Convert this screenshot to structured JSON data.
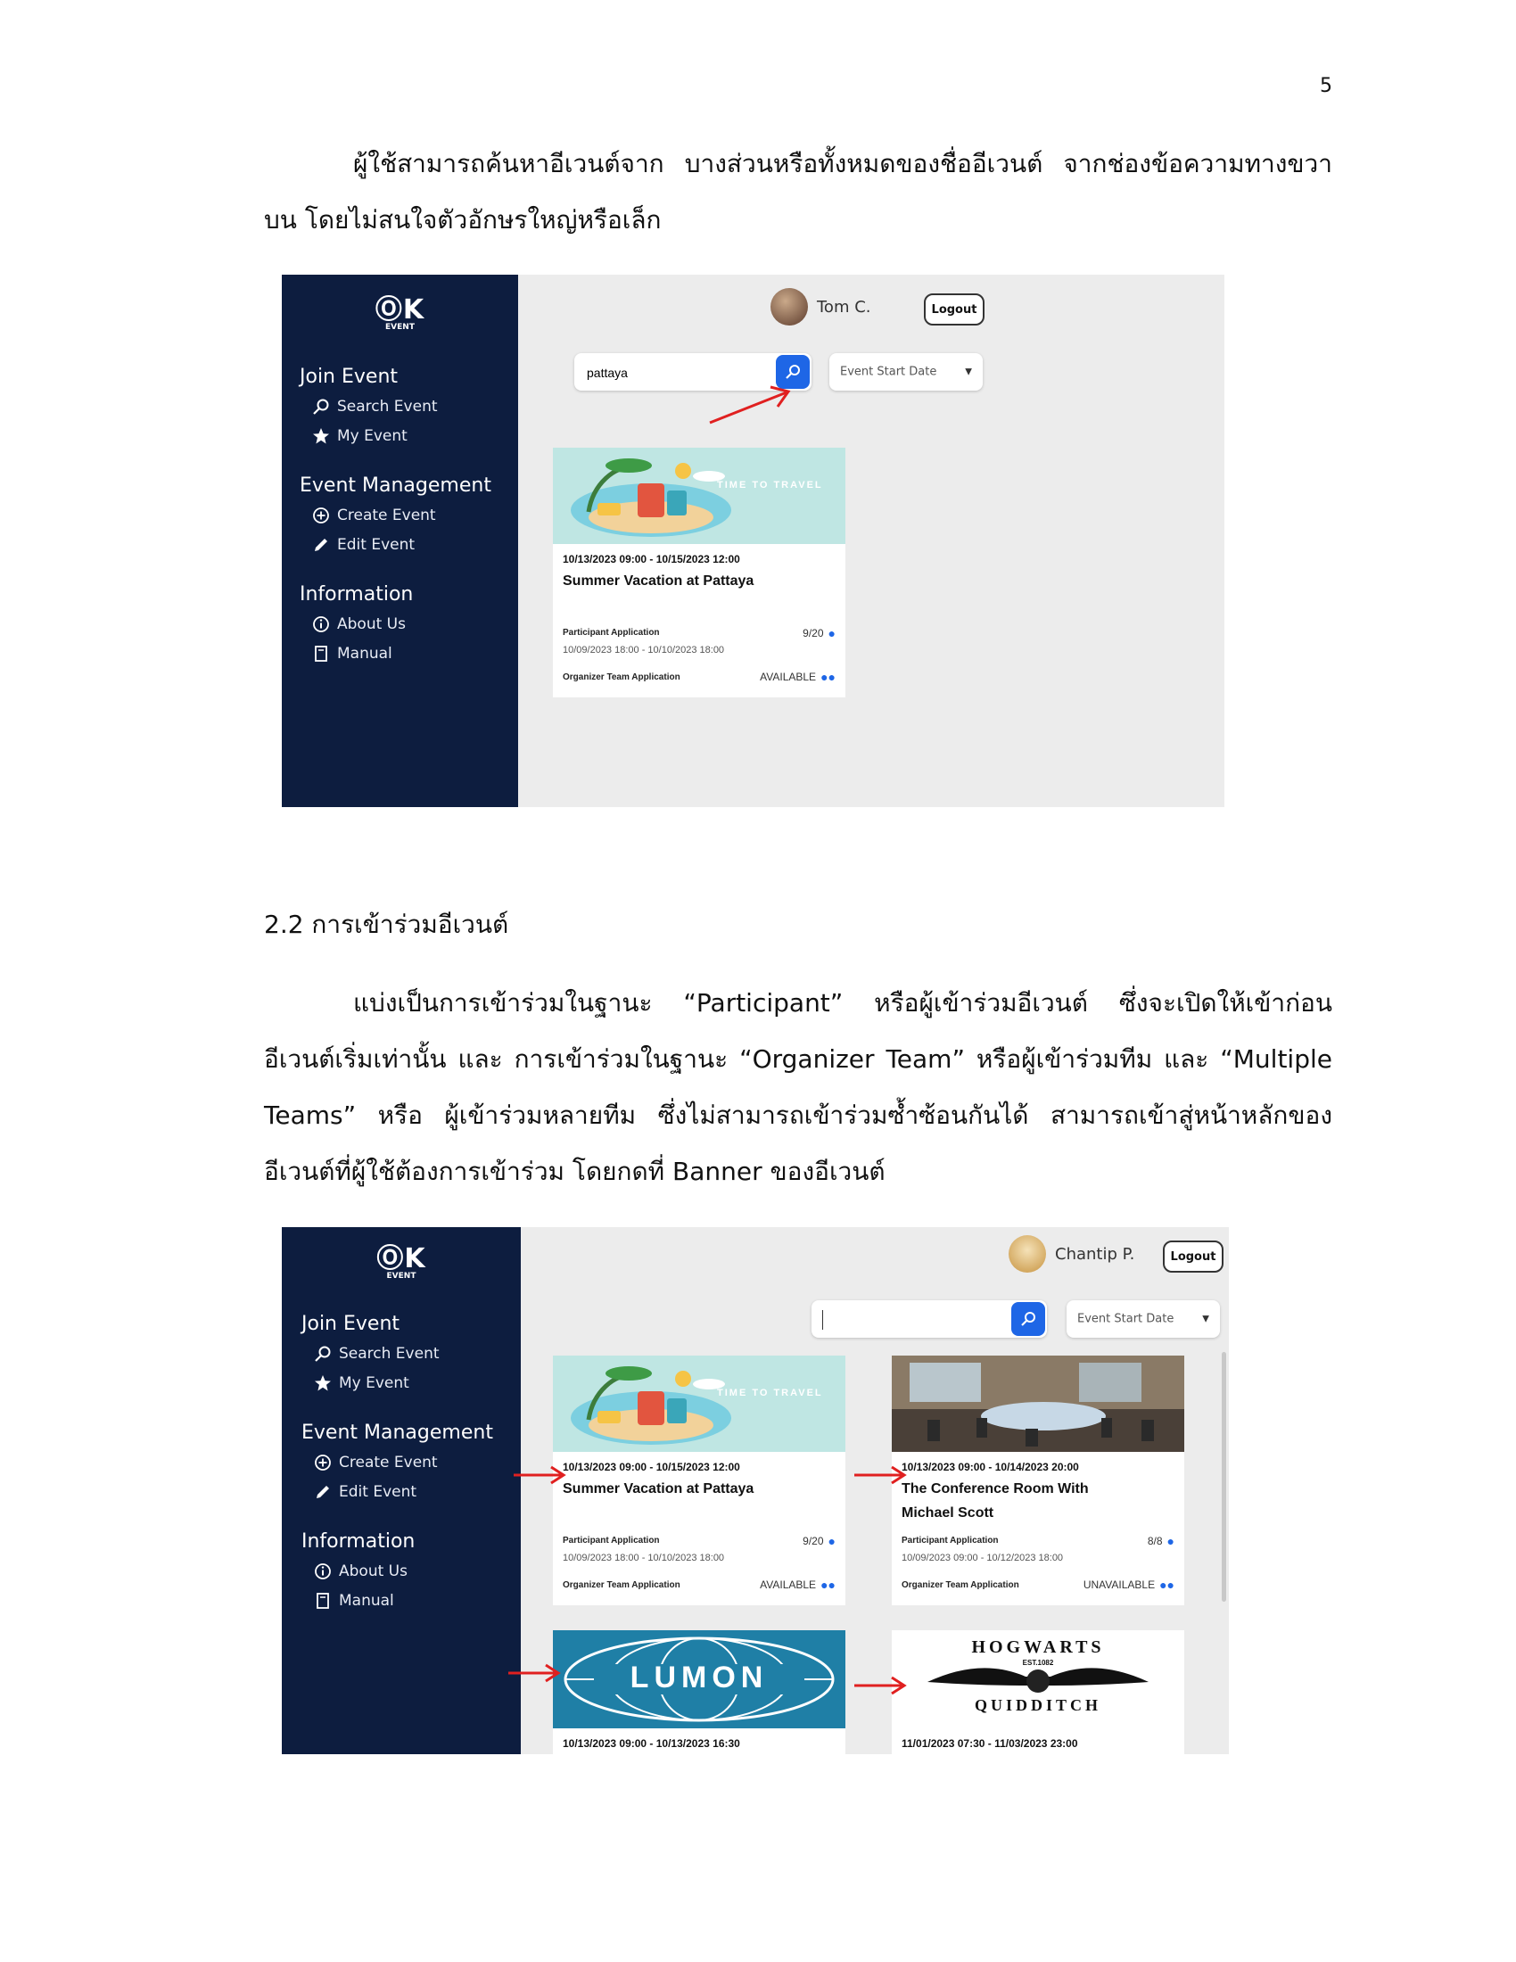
{
  "page_number": "5",
  "intro_paragraph": "ผู้ใช้สามารถค้นหาอีเวนต์จาก บางส่วนหรือทั้งหมดของชื่ออีเวนต์ จากช่องข้อความทางขวาบน โดยไม่สนใจตัวอักษรใหญ่หรือเล็ก",
  "section_heading": "2.2 การเข้าร่วมอีเวนต์",
  "section_paragraph": "แบ่งเป็นการเข้าร่วมในฐานะ “Participant” หรือผู้เข้าร่วมอีเวนต์ ซึ่งจะเปิดให้เข้าก่อน อีเวนต์เริ่มเท่านั้น และ การเข้าร่วมในฐานะ “Organizer Team” หรือผู้เข้าร่วมทีม และ “Multiple Teams” หรือ ผู้เข้าร่วมหลายทีม ซึ่งไม่สามารถเข้าร่วมซ้ำซ้อนกันได้ สามารถเข้าสู่หน้าหลักของอีเวนต์ที่ผู้ใช้ต้องการเข้าร่วม โดยกดที่ Banner ของอีเวนต์",
  "sidebar": {
    "logo": "ⓄK",
    "logo_sub": "EVENT",
    "join_title": "Join Event",
    "search_event": "Search Event",
    "my_event": "My Event",
    "mgmt_title": "Event Management",
    "create_event": "Create Event",
    "edit_event": "Edit Event",
    "info_title": "Information",
    "about_us": "About Us",
    "manual": "Manual"
  },
  "screenshot1": {
    "user_name": "Tom C.",
    "logout": "Logout",
    "search_value": "pattaya",
    "sort_label": "Event Start Date",
    "card": {
      "banner_text": "TIME TO TRAVEL",
      "date": "10/13/2023 09:00 - 10/15/2023 12:00",
      "title": "Summer Vacation at Pattaya",
      "participant_label": "Participant Application",
      "participant_count": "9/20",
      "participant_range": "10/09/2023 18:00 - 10/10/2023 18:00",
      "team_label": "Organizer Team Application",
      "team_status": "AVAILABLE"
    }
  },
  "screenshot2": {
    "user_name": "Chantip P.",
    "logout": "Logout",
    "search_value": "",
    "sort_label": "Event Start Date",
    "cards": [
      {
        "banner_text": "TIME TO TRAVEL",
        "date": "10/13/2023 09:00 - 10/15/2023 12:00",
        "title": "Summer Vacation at Pattaya",
        "participant_label": "Participant Application",
        "participant_count": "9/20",
        "participant_range": "10/09/2023 18:00 - 10/10/2023 18:00",
        "team_label": "Organizer Team Application",
        "team_status": "AVAILABLE"
      },
      {
        "date": "10/13/2023 09:00 - 10/14/2023 20:00",
        "title": "The Conference Room With Michael Scott",
        "participant_label": "Participant Application",
        "participant_count": "8/8",
        "participant_range": "10/09/2023 09:00 - 10/12/2023 18:00",
        "team_label": "Organizer Team Application",
        "team_status": "UNAVAILABLE"
      },
      {
        "banner_text": "LUMON",
        "date": "10/13/2023 09:00 - 10/13/2023 16:30"
      },
      {
        "banner_text_top": "HOGWARTS",
        "banner_text_mid": "EST.1082",
        "banner_text_bottom": "QUIDDITCH",
        "date": "11/01/2023 07:30 - 11/03/2023 23:00"
      }
    ]
  },
  "colors": {
    "sidebar": "#0d1d3f",
    "content_bg": "#ececec",
    "accent": "#1e66e6",
    "annotation_arrow": "#e02020"
  }
}
